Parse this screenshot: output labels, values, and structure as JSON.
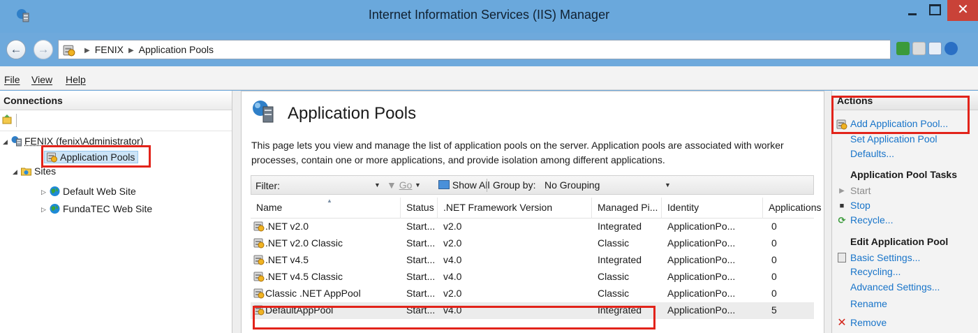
{
  "window": {
    "title": "Internet Information Services (IIS) Manager",
    "close_glyph": "✕"
  },
  "address": {
    "crumbs": [
      "FENIX",
      "Application Pools"
    ],
    "separator": "▶"
  },
  "menu": {
    "file": "File",
    "view": "View",
    "help": "Help"
  },
  "connections": {
    "header": "Connections",
    "tree": {
      "server": "FENIX (fenix\\Administrator)",
      "app_pools": "Application Pools",
      "sites": "Sites",
      "site1": "Default Web Site",
      "site2": "FundaTEC Web Site"
    }
  },
  "center": {
    "title": "Application Pools",
    "description": "This page lets you view and manage the list of application pools on the server. Application pools are associated with worker processes, contain one or more applications, and provide isolation among different applications.",
    "filter": {
      "label": "Filter:",
      "go": "Go",
      "show_all": "Show All",
      "group_by_label": "Group by:",
      "group_by_value": "No Grouping"
    },
    "columns": [
      "Name",
      "Status",
      ".NET Framework Version",
      "Managed Pi...",
      "Identity",
      "Applications"
    ],
    "rows": [
      {
        "name": ".NET v2.0",
        "status": "Start...",
        "version": "v2.0",
        "pipeline": "Integrated",
        "identity": "ApplicationPo...",
        "apps": "0"
      },
      {
        "name": ".NET v2.0 Classic",
        "status": "Start...",
        "version": "v2.0",
        "pipeline": "Classic",
        "identity": "ApplicationPo...",
        "apps": "0"
      },
      {
        "name": ".NET v4.5",
        "status": "Start...",
        "version": "v4.0",
        "pipeline": "Integrated",
        "identity": "ApplicationPo...",
        "apps": "0"
      },
      {
        "name": ".NET v4.5 Classic",
        "status": "Start...",
        "version": "v4.0",
        "pipeline": "Classic",
        "identity": "ApplicationPo...",
        "apps": "0"
      },
      {
        "name": "Classic .NET AppPool",
        "status": "Start...",
        "version": "v2.0",
        "pipeline": "Classic",
        "identity": "ApplicationPo...",
        "apps": "0"
      },
      {
        "name": "DefaultAppPool",
        "status": "Start...",
        "version": "v4.0",
        "pipeline": "Integrated",
        "identity": "ApplicationPo...",
        "apps": "5"
      }
    ]
  },
  "actions": {
    "header": "Actions",
    "add_pool": "Add Application Pool...",
    "set_defaults_1": "Set Application Pool",
    "set_defaults_2": "Defaults...",
    "tasks_header": "Application Pool Tasks",
    "start": "Start",
    "stop": "Stop",
    "recycle": "Recycle...",
    "edit_header": "Edit Application Pool",
    "basic_settings": "Basic Settings...",
    "recycling": "Recycling...",
    "advanced_settings": "Advanced Settings...",
    "rename": "Rename",
    "remove": "Remove"
  },
  "colors": {
    "title_bar": "#6aa8dc",
    "close_button": "#c94238",
    "link": "#1874c9",
    "highlight": "#e2231a"
  }
}
